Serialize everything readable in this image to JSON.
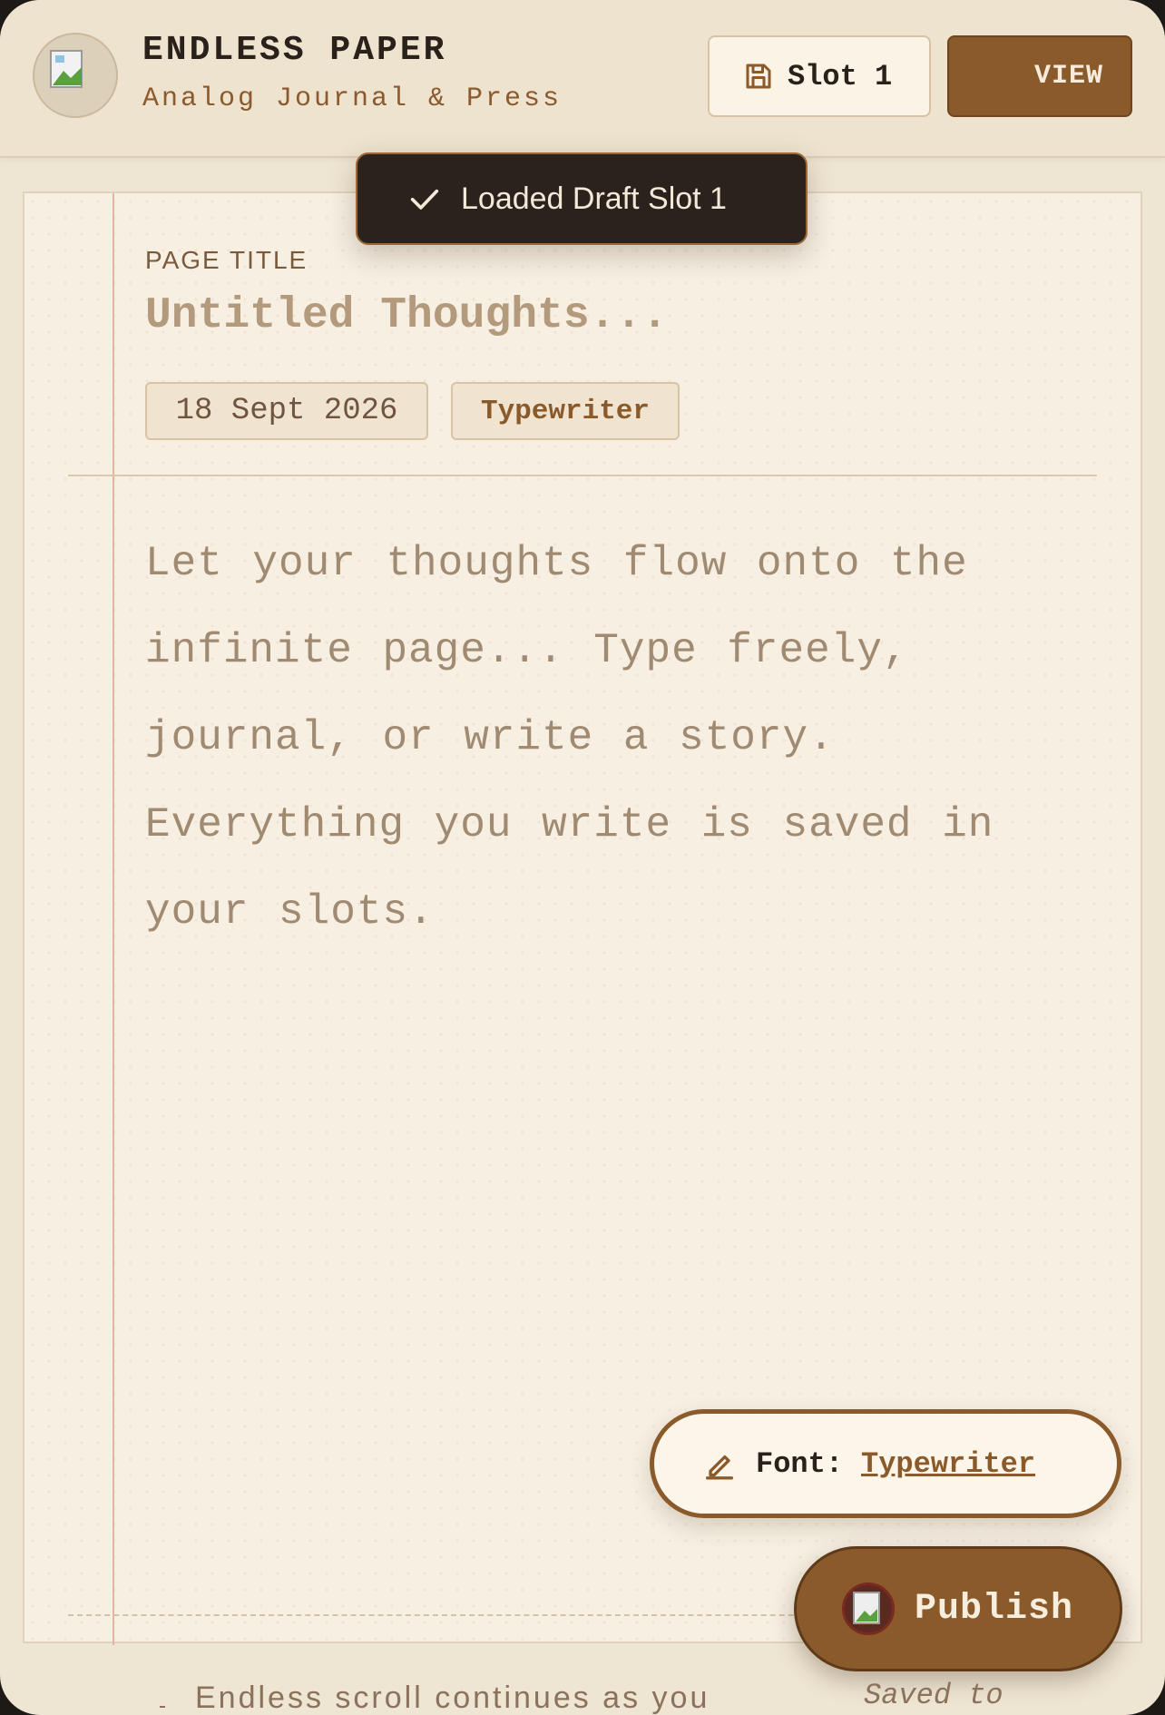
{
  "header": {
    "title": "ENDLESS PAPER",
    "subtitle": "Analog Journal & Press",
    "slot_label": "Slot 1",
    "view_label": "VIEW"
  },
  "toast": {
    "message": "Loaded Draft Slot 1"
  },
  "editor": {
    "title_label": "PAGE TITLE",
    "title_placeholder": "Untitled Thoughts...",
    "date": "18 Sept 2026",
    "font_chip": "Typewriter",
    "body_placeholder": "Let your thoughts flow onto the infinite page... Type freely, journal, or write a story. Everything you write is saved in your slots."
  },
  "font_selector": {
    "label": "Font:",
    "value": "Typewriter"
  },
  "publish": {
    "label": "Publish"
  },
  "footer": {
    "left_text": "Endless scroll continues as you",
    "right_text": "Saved to"
  },
  "colors": {
    "accent": "#8b5a2b",
    "paper": "#f6efe2",
    "header_bg": "#ede3cf",
    "toast_bg": "#2c221d"
  },
  "icons": {
    "avatar": "broken-image-icon",
    "slot": "floppy-disk-icon",
    "toast": "check-icon",
    "font": "pen-edit-icon",
    "publish": "broken-image-icon"
  }
}
